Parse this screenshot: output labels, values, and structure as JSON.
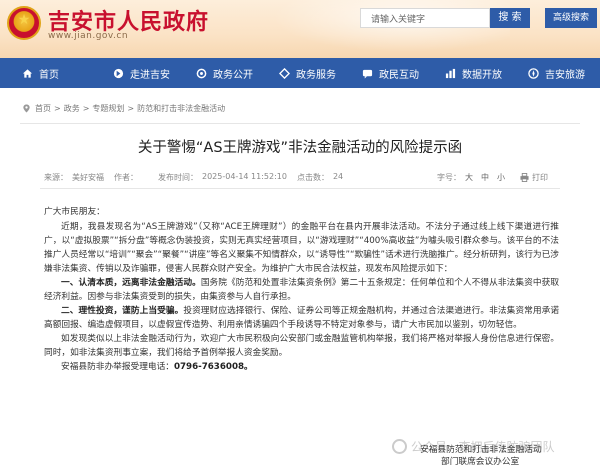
{
  "header": {
    "site_title": "吉安市人民政府",
    "site_url": "www.jian.gov.cn",
    "search_placeholder": "请输入关键字",
    "search_label": "搜 索",
    "hk_label": "高级搜索"
  },
  "nav": {
    "items": [
      {
        "label": "首页",
        "icon": "home-icon"
      },
      {
        "label": "走进吉安",
        "icon": "bookmark-icon"
      },
      {
        "label": "政务公开",
        "icon": "gear-icon"
      },
      {
        "label": "政务服务",
        "icon": "service-icon"
      },
      {
        "label": "政民互动",
        "icon": "chat-icon"
      },
      {
        "label": "数据开放",
        "icon": "chart-icon"
      },
      {
        "label": "吉安旅游",
        "icon": "travel-icon"
      }
    ]
  },
  "breadcrumb": {
    "items": [
      "首页",
      "政务",
      "专题规划",
      "防范和打击非法金融活动"
    ]
  },
  "article": {
    "title": "关于警惕“AS王牌游戏”非法金融活动的风险提示函",
    "source_label": "来源：",
    "source": "美好安福",
    "author_label": "作者：",
    "author": "",
    "date_label": "发布时间：",
    "date": "2025-04-14 11:52:10",
    "views_label": "点击数：",
    "views": "24",
    "font_label": "字号：",
    "font_big": "大",
    "font_mid": "中",
    "font_small": "小",
    "print_label": "打印",
    "salutation": "广大市民朋友：",
    "p1": "近期，我县发现名为“AS王牌游戏”（又称“ACE王牌理财”）的金融平台在县内开展非法活动。不法分子通过线上线下渠道进行推广，以“虚拟股票”“拆分盘”等概念伪装投资，实则无真实经营项目，以“游戏理财”“400%高收益”为噱头吸引群众参与。该平台的不法推广人员经常以“培训”“聚会”“聚餐”“讲座”等名义聚集不知情群众，以“诱导性”“欺骗性”话术进行洗脑推广。经分析研判，该行为已涉嫌非法集资、传销以及诈骗罪，侵害人民群众财产安全。为维护广大市民合法权益，现发布风险提示如下：",
    "p2_strong": "一、认清本质，远离非法金融活动。",
    "p2": "国务院《防范和处置非法集资条例》第二十五条规定：任何单位和个人不得从非法集资中获取经济利益。因参与非法集资受到的损失，由集资参与人自行承担。",
    "p3_strong": "二、理性投资，谨防上当受骗。",
    "p3": "投资理财应选择银行、保险、证券公司等正规金融机构，并通过合法渠道进行。非法集资常用承诺高额回报、编造虚假项目，以虚假宣传造势、利用亲情诱骗四个手段诱导不特定对象参与，请广大市民加以鉴别，切勿轻信。",
    "p4": "如发现类似以上非法金融活动行为，欢迎广大市民积极向公安部门或金融监管机构举报，我们将严格对举报人身份信息进行保密。同时，如非法集资刑事立案，我们将给予首例举报人资金奖励。",
    "hotline_label": "安福县防非办举报受理电话：",
    "hotline": "0796-7636008。",
    "sign_line1": "安福县防范和打击非法金融活动",
    "sign_line2": "部门联席会议办公室"
  },
  "watermark": {
    "text": "公众号 · 李拥后传防骗团队"
  }
}
